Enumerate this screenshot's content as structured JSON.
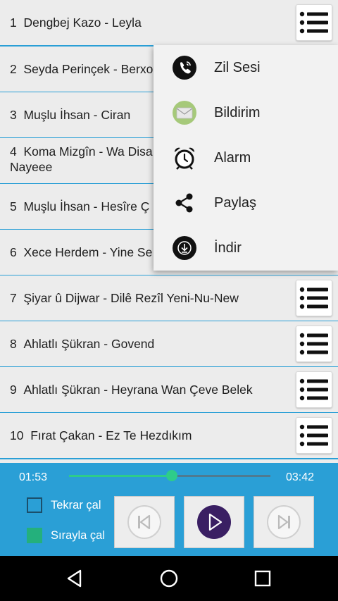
{
  "songs": [
    {
      "num": "1",
      "title": "Dengbej Kazo - Leyla"
    },
    {
      "num": "2",
      "title": "Seyda Perinçek - Berxo"
    },
    {
      "num": "3",
      "title": "Muşlu İhsan - Ciran"
    },
    {
      "num": "4",
      "title": "Koma Mizgîn - Wa Disa",
      "title2": "Nayeee"
    },
    {
      "num": "5",
      "title": "Muşlu İhsan - Hesîre Ç"
    },
    {
      "num": "6",
      "title": "Xece Herdem - Yine Se"
    },
    {
      "num": "7",
      "title": "Şiyar û Dijwar - Dilê Rezîl Yeni-Nu-New"
    },
    {
      "num": "8",
      "title": "Ahlatlı Şükran - Govend"
    },
    {
      "num": "9",
      "title": "Ahlatlı Şükran - Heyrana Wan Çeve Belek"
    },
    {
      "num": "10",
      "title": "Fırat Çakan - Ez Te Hezdıkım"
    }
  ],
  "row_menu_icon": "list-menu-icon",
  "popup_menu": {
    "items": [
      {
        "label": "Zil Sesi",
        "icon": "ringtone-phone-icon"
      },
      {
        "label": "Bildirim",
        "icon": "notification-envelope-icon"
      },
      {
        "label": "Alarm",
        "icon": "alarm-clock-icon"
      },
      {
        "label": "Paylaş",
        "icon": "share-icon"
      },
      {
        "label": "İndir",
        "icon": "download-icon"
      }
    ]
  },
  "player": {
    "elapsed": "01:53",
    "duration": "03:42",
    "progress": 0.51,
    "repeat_label": "Tekrar çal",
    "repeat_checked": false,
    "sequential_label": "Sırayla çal",
    "sequential_checked": true
  },
  "colors": {
    "accent": "#2a9fd6",
    "progress": "#2ecc8a",
    "play_button": "#3a1f63",
    "list_background": "#ececec"
  }
}
